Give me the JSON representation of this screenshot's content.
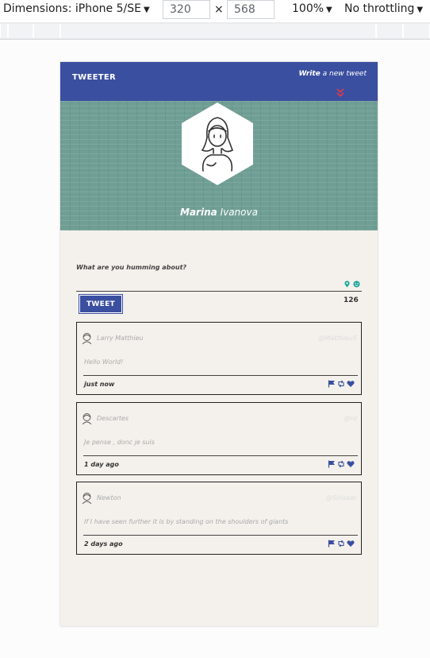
{
  "devtools": {
    "dimensions_label": "Dimensions: iPhone 5/SE",
    "width": "320",
    "height": "568",
    "times": "×",
    "zoom": "100%",
    "throttling": "No throttling",
    "caret": "▼"
  },
  "navbar": {
    "brand": "TWEETER",
    "write_bold": "Write",
    "write_rest": " a new tweet",
    "accent_color": "#e8374a",
    "bar_color": "#3b4fa0"
  },
  "profile": {
    "first_name": "Marina",
    "last_name": "Ivanova",
    "hero_color": "#6f9e94"
  },
  "compose": {
    "label": "What are you humming about?",
    "placeholder": "",
    "char_count": "126",
    "button_label": "TWEET",
    "tool_icons": [
      "map-pin-icon",
      "emoji-icon"
    ],
    "tool_colors": [
      "#1aa39a",
      "#1aa39a"
    ]
  },
  "tweets": [
    {
      "name": "Larry Matthieu",
      "handle": "@Matthieu5",
      "text": "Hello World!",
      "time": "just now"
    },
    {
      "name": "Descartes",
      "handle": "@rd",
      "text": "Je pense , donc je suis",
      "time": "1 day ago"
    },
    {
      "name": "Newton",
      "handle": "@Sirisaac",
      "text": "If I have seen further it is by standing on the shoulders of giants",
      "time": "2 days ago"
    }
  ],
  "tweet_actions": [
    "flag-icon",
    "retweet-icon",
    "heart-icon"
  ],
  "action_color": "#3b4fa0"
}
